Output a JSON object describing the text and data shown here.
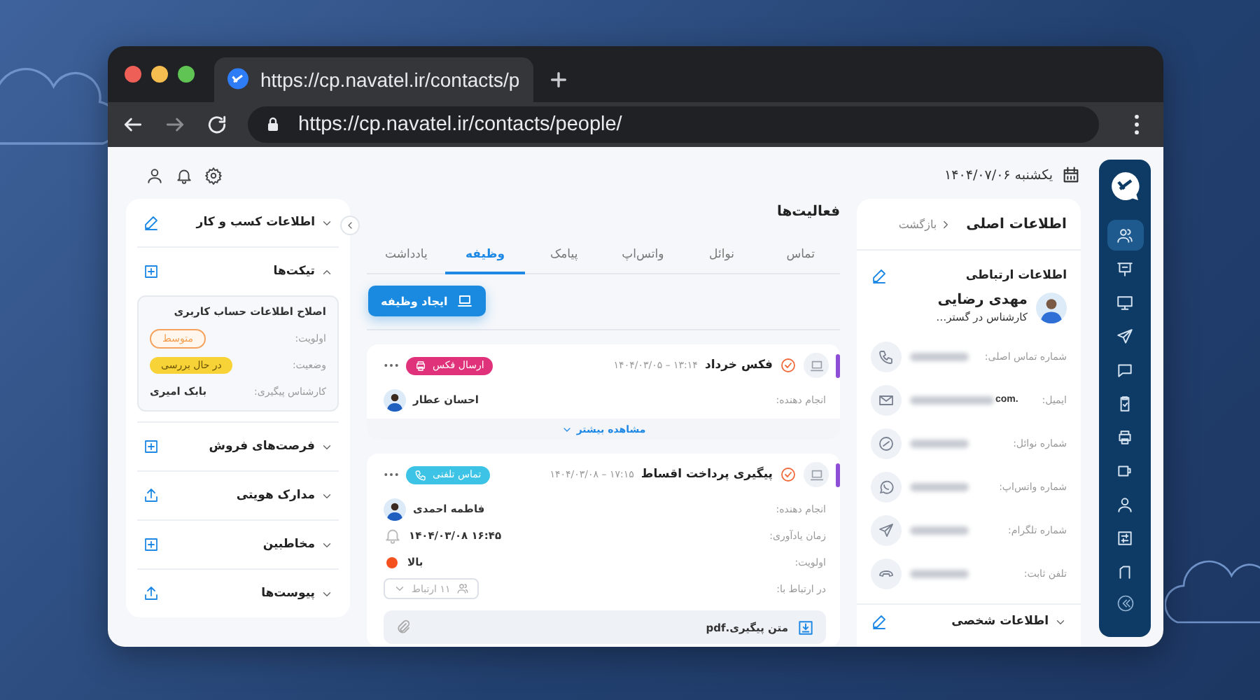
{
  "browser": {
    "tab_title": "https://cp.navatel.ir/contacts/p",
    "url": "https://cp.navatel.ir/contacts/people/"
  },
  "header": {
    "date": "یکشنبه ۱۴۰۴/۰۷/۰۶"
  },
  "sidebar": {
    "items": [
      {
        "selected": true
      },
      {
        "selected": false
      },
      {
        "selected": false
      },
      {
        "selected": false
      },
      {
        "selected": false
      },
      {
        "selected": false
      },
      {
        "selected": false
      },
      {
        "selected": false
      },
      {
        "selected": false
      },
      {
        "selected": false
      },
      {
        "selected": false
      }
    ]
  },
  "contact_panel": {
    "back": "بازگشت",
    "title": "اطلاعات اصلی",
    "section": "اطلاعات ارتباطی",
    "name": "مهدی رضایی",
    "role": "کارشناس در گستر…",
    "rows": [
      {
        "kind": "phone",
        "label": "شماره تماس اصلی:"
      },
      {
        "kind": "email",
        "label": "ایمیل:",
        "visible_suffix": ".com"
      },
      {
        "kind": "navatel",
        "label": "شماره نوائل:"
      },
      {
        "kind": "whatsapp",
        "label": "شماره واتس‌اپ:"
      },
      {
        "kind": "telegram",
        "label": "شماره تلگرام:"
      },
      {
        "kind": "landline",
        "label": "تلفن ثابت:"
      }
    ],
    "collapsed_section": {
      "title": "اطلاعات شخصی",
      "expanded": false
    }
  },
  "activities": {
    "title": "فعالیت‌ها",
    "tabs": [
      {
        "label": "تماس",
        "selected": false
      },
      {
        "label": "نوائل",
        "selected": false
      },
      {
        "label": "واتس‌اپ",
        "selected": false
      },
      {
        "label": "پیامک",
        "selected": false
      },
      {
        "label": "وظیفه",
        "selected": true
      },
      {
        "label": "یادداشت",
        "selected": false
      }
    ],
    "create_button": "ایجاد وظیفه",
    "cards": [
      {
        "title": "فکس خرداد",
        "datetime": "۱۴۰۴/۰۳/۰۵ – ۱۳:۱۴",
        "tag": {
          "kind": "fax",
          "label": "ارسال فکس",
          "color": "#e0327a"
        },
        "fields": [
          {
            "kind": "person",
            "label": "انجام دهنده:",
            "value": "احسان عطار"
          }
        ],
        "more": "مشاهده بیشتر"
      },
      {
        "title": "پیگیری پرداخت اقساط",
        "datetime": "۱۴۰۴/۰۳/۰۸ – ۱۷:۱۵",
        "tag": {
          "kind": "phone",
          "label": "تماس تلفنی",
          "color": "#3cc3e6"
        },
        "fields": [
          {
            "kind": "person",
            "label": "انجام دهنده:",
            "value": "فاطمه احمدی"
          },
          {
            "kind": "reminder",
            "label": "زمان یادآوری:",
            "value": "۱۴۰۴/۰۳/۰۸ ۱۶:۴۵"
          },
          {
            "kind": "priority",
            "label": "اولویت:",
            "value": "بالا",
            "color": "#f4511e"
          },
          {
            "kind": "relations",
            "label": "در ارتباط با:",
            "value": "۱۱ ارتباط"
          }
        ],
        "attachment": "متن پیگیری.pdf"
      }
    ]
  },
  "business_panel": {
    "sections": [
      {
        "title": "اطلاعات کسب و کار",
        "expanded": false,
        "kind": "edit"
      },
      {
        "title": "تیکت‌ها",
        "expanded": true,
        "kind": "add",
        "ticket": {
          "title": "اصلاح اطلاعات حساب کاربری",
          "fields": [
            {
              "kind": "outline",
              "label": "اولویت:",
              "value": "متوسط"
            },
            {
              "kind": "filled",
              "label": "وضعیت:",
              "value": "در حال بررسی"
            },
            {
              "kind": "text",
              "label": "کارشناس پیگیری:",
              "value": "بابک امیری"
            }
          ]
        }
      },
      {
        "title": "فرصت‌های فروش",
        "expanded": false,
        "kind": "add"
      },
      {
        "title": "مدارک هویتی",
        "expanded": false,
        "kind": "upload"
      },
      {
        "title": "مخاطبین",
        "expanded": false,
        "kind": "add"
      },
      {
        "title": "پیوست‌ها",
        "expanded": false,
        "kind": "upload"
      }
    ]
  }
}
